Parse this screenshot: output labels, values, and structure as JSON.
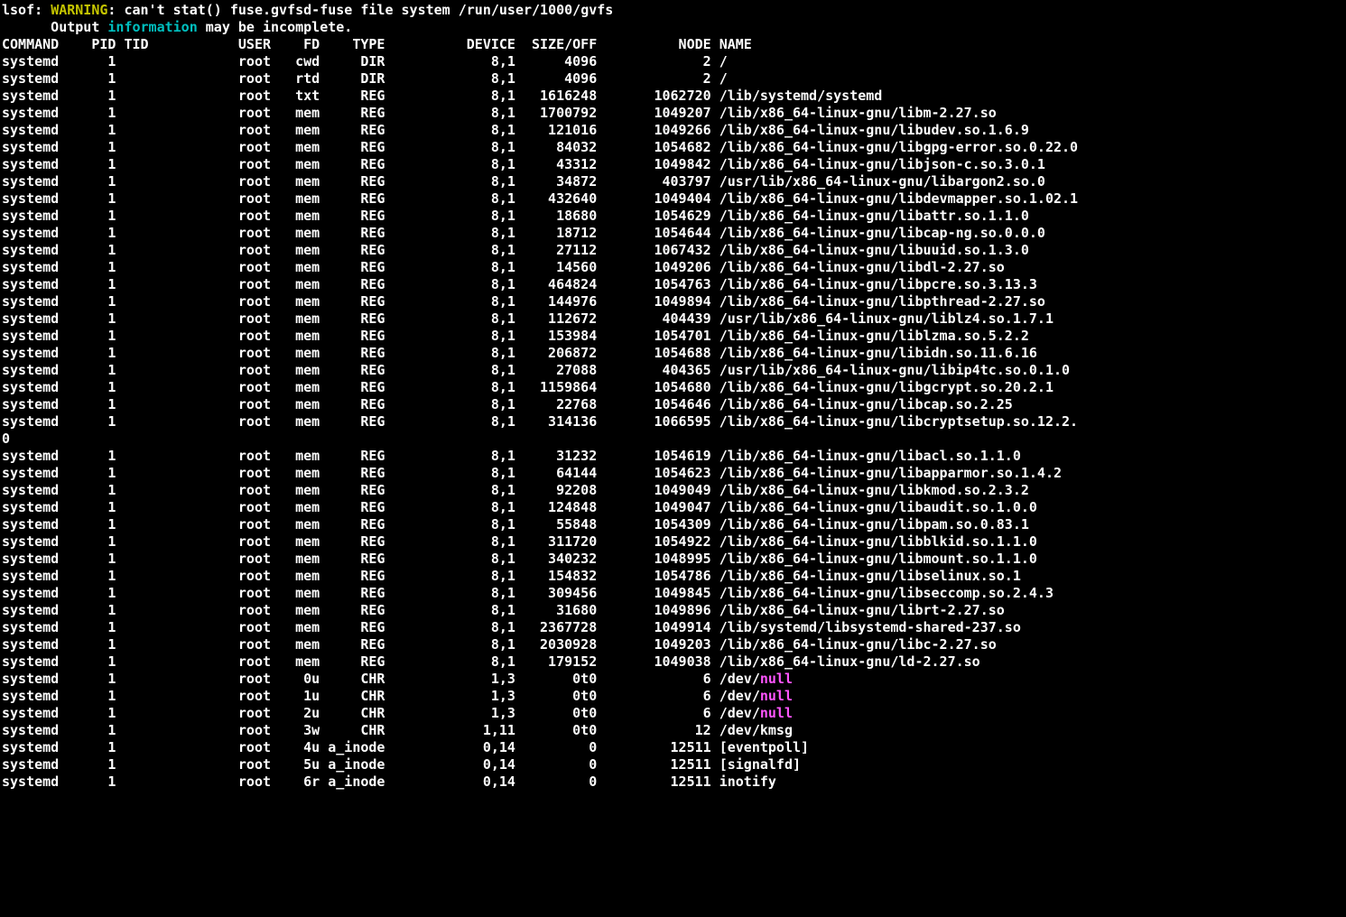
{
  "warn1": {
    "cmd": "lsof:",
    "tag": "WARNING",
    "msg": ": can't stat() fuse.gvfsd-fuse file system /run/user/1000/gvfs"
  },
  "warn2": {
    "pre": "      Output ",
    "kw": "information",
    "post": " may be incomplete."
  },
  "headers": {
    "COMMAND": "COMMAND",
    "PID": "PID",
    "TID": "TID",
    "USER": "USER",
    "FD": "FD",
    "TYPE": "TYPE",
    "DEVICE": "DEVICE",
    "SIZEOFF": "SIZE/OFF",
    "NODE": "NODE",
    "NAME": "NAME"
  },
  "rows": [
    {
      "COMMAND": "systemd",
      "PID": "1",
      "TID": "",
      "USER": "root",
      "FD": "cwd",
      "TYPE": "DIR",
      "DEVICE": "8,1",
      "SIZEOFF": "4096",
      "NODE": "2",
      "NAME": "/"
    },
    {
      "COMMAND": "systemd",
      "PID": "1",
      "TID": "",
      "USER": "root",
      "FD": "rtd",
      "TYPE": "DIR",
      "DEVICE": "8,1",
      "SIZEOFF": "4096",
      "NODE": "2",
      "NAME": "/"
    },
    {
      "COMMAND": "systemd",
      "PID": "1",
      "TID": "",
      "USER": "root",
      "FD": "txt",
      "TYPE": "REG",
      "DEVICE": "8,1",
      "SIZEOFF": "1616248",
      "NODE": "1062720",
      "NAME": "/lib/systemd/systemd"
    },
    {
      "COMMAND": "systemd",
      "PID": "1",
      "TID": "",
      "USER": "root",
      "FD": "mem",
      "TYPE": "REG",
      "DEVICE": "8,1",
      "SIZEOFF": "1700792",
      "NODE": "1049207",
      "NAME": "/lib/x86_64-linux-gnu/libm-2.27.so"
    },
    {
      "COMMAND": "systemd",
      "PID": "1",
      "TID": "",
      "USER": "root",
      "FD": "mem",
      "TYPE": "REG",
      "DEVICE": "8,1",
      "SIZEOFF": "121016",
      "NODE": "1049266",
      "NAME": "/lib/x86_64-linux-gnu/libudev.so.1.6.9"
    },
    {
      "COMMAND": "systemd",
      "PID": "1",
      "TID": "",
      "USER": "root",
      "FD": "mem",
      "TYPE": "REG",
      "DEVICE": "8,1",
      "SIZEOFF": "84032",
      "NODE": "1054682",
      "NAME": "/lib/x86_64-linux-gnu/libgpg-error.so.0.22.0"
    },
    {
      "COMMAND": "systemd",
      "PID": "1",
      "TID": "",
      "USER": "root",
      "FD": "mem",
      "TYPE": "REG",
      "DEVICE": "8,1",
      "SIZEOFF": "43312",
      "NODE": "1049842",
      "NAME": "/lib/x86_64-linux-gnu/libjson-c.so.3.0.1"
    },
    {
      "COMMAND": "systemd",
      "PID": "1",
      "TID": "",
      "USER": "root",
      "FD": "mem",
      "TYPE": "REG",
      "DEVICE": "8,1",
      "SIZEOFF": "34872",
      "NODE": "403797",
      "NAME": "/usr/lib/x86_64-linux-gnu/libargon2.so.0"
    },
    {
      "COMMAND": "systemd",
      "PID": "1",
      "TID": "",
      "USER": "root",
      "FD": "mem",
      "TYPE": "REG",
      "DEVICE": "8,1",
      "SIZEOFF": "432640",
      "NODE": "1049404",
      "NAME": "/lib/x86_64-linux-gnu/libdevmapper.so.1.02.1"
    },
    {
      "COMMAND": "systemd",
      "PID": "1",
      "TID": "",
      "USER": "root",
      "FD": "mem",
      "TYPE": "REG",
      "DEVICE": "8,1",
      "SIZEOFF": "18680",
      "NODE": "1054629",
      "NAME": "/lib/x86_64-linux-gnu/libattr.so.1.1.0"
    },
    {
      "COMMAND": "systemd",
      "PID": "1",
      "TID": "",
      "USER": "root",
      "FD": "mem",
      "TYPE": "REG",
      "DEVICE": "8,1",
      "SIZEOFF": "18712",
      "NODE": "1054644",
      "NAME": "/lib/x86_64-linux-gnu/libcap-ng.so.0.0.0"
    },
    {
      "COMMAND": "systemd",
      "PID": "1",
      "TID": "",
      "USER": "root",
      "FD": "mem",
      "TYPE": "REG",
      "DEVICE": "8,1",
      "SIZEOFF": "27112",
      "NODE": "1067432",
      "NAME": "/lib/x86_64-linux-gnu/libuuid.so.1.3.0"
    },
    {
      "COMMAND": "systemd",
      "PID": "1",
      "TID": "",
      "USER": "root",
      "FD": "mem",
      "TYPE": "REG",
      "DEVICE": "8,1",
      "SIZEOFF": "14560",
      "NODE": "1049206",
      "NAME": "/lib/x86_64-linux-gnu/libdl-2.27.so"
    },
    {
      "COMMAND": "systemd",
      "PID": "1",
      "TID": "",
      "USER": "root",
      "FD": "mem",
      "TYPE": "REG",
      "DEVICE": "8,1",
      "SIZEOFF": "464824",
      "NODE": "1054763",
      "NAME": "/lib/x86_64-linux-gnu/libpcre.so.3.13.3"
    },
    {
      "COMMAND": "systemd",
      "PID": "1",
      "TID": "",
      "USER": "root",
      "FD": "mem",
      "TYPE": "REG",
      "DEVICE": "8,1",
      "SIZEOFF": "144976",
      "NODE": "1049894",
      "NAME": "/lib/x86_64-linux-gnu/libpthread-2.27.so"
    },
    {
      "COMMAND": "systemd",
      "PID": "1",
      "TID": "",
      "USER": "root",
      "FD": "mem",
      "TYPE": "REG",
      "DEVICE": "8,1",
      "SIZEOFF": "112672",
      "NODE": "404439",
      "NAME": "/usr/lib/x86_64-linux-gnu/liblz4.so.1.7.1"
    },
    {
      "COMMAND": "systemd",
      "PID": "1",
      "TID": "",
      "USER": "root",
      "FD": "mem",
      "TYPE": "REG",
      "DEVICE": "8,1",
      "SIZEOFF": "153984",
      "NODE": "1054701",
      "NAME": "/lib/x86_64-linux-gnu/liblzma.so.5.2.2"
    },
    {
      "COMMAND": "systemd",
      "PID": "1",
      "TID": "",
      "USER": "root",
      "FD": "mem",
      "TYPE": "REG",
      "DEVICE": "8,1",
      "SIZEOFF": "206872",
      "NODE": "1054688",
      "NAME": "/lib/x86_64-linux-gnu/libidn.so.11.6.16"
    },
    {
      "COMMAND": "systemd",
      "PID": "1",
      "TID": "",
      "USER": "root",
      "FD": "mem",
      "TYPE": "REG",
      "DEVICE": "8,1",
      "SIZEOFF": "27088",
      "NODE": "404365",
      "NAME": "/usr/lib/x86_64-linux-gnu/libip4tc.so.0.1.0"
    },
    {
      "COMMAND": "systemd",
      "PID": "1",
      "TID": "",
      "USER": "root",
      "FD": "mem",
      "TYPE": "REG",
      "DEVICE": "8,1",
      "SIZEOFF": "1159864",
      "NODE": "1054680",
      "NAME": "/lib/x86_64-linux-gnu/libgcrypt.so.20.2.1"
    },
    {
      "COMMAND": "systemd",
      "PID": "1",
      "TID": "",
      "USER": "root",
      "FD": "mem",
      "TYPE": "REG",
      "DEVICE": "8,1",
      "SIZEOFF": "22768",
      "NODE": "1054646",
      "NAME": "/lib/x86_64-linux-gnu/libcap.so.2.25"
    },
    {
      "COMMAND": "systemd",
      "PID": "1",
      "TID": "",
      "USER": "root",
      "FD": "mem",
      "TYPE": "REG",
      "DEVICE": "8,1",
      "SIZEOFF": "314136",
      "NODE": "1066595",
      "NAME": "/lib/x86_64-linux-gnu/libcryptsetup.so.12.2.",
      "WRAP": "0"
    },
    {
      "COMMAND": "systemd",
      "PID": "1",
      "TID": "",
      "USER": "root",
      "FD": "mem",
      "TYPE": "REG",
      "DEVICE": "8,1",
      "SIZEOFF": "31232",
      "NODE": "1054619",
      "NAME": "/lib/x86_64-linux-gnu/libacl.so.1.1.0"
    },
    {
      "COMMAND": "systemd",
      "PID": "1",
      "TID": "",
      "USER": "root",
      "FD": "mem",
      "TYPE": "REG",
      "DEVICE": "8,1",
      "SIZEOFF": "64144",
      "NODE": "1054623",
      "NAME": "/lib/x86_64-linux-gnu/libapparmor.so.1.4.2"
    },
    {
      "COMMAND": "systemd",
      "PID": "1",
      "TID": "",
      "USER": "root",
      "FD": "mem",
      "TYPE": "REG",
      "DEVICE": "8,1",
      "SIZEOFF": "92208",
      "NODE": "1049049",
      "NAME": "/lib/x86_64-linux-gnu/libkmod.so.2.3.2"
    },
    {
      "COMMAND": "systemd",
      "PID": "1",
      "TID": "",
      "USER": "root",
      "FD": "mem",
      "TYPE": "REG",
      "DEVICE": "8,1",
      "SIZEOFF": "124848",
      "NODE": "1049047",
      "NAME": "/lib/x86_64-linux-gnu/libaudit.so.1.0.0"
    },
    {
      "COMMAND": "systemd",
      "PID": "1",
      "TID": "",
      "USER": "root",
      "FD": "mem",
      "TYPE": "REG",
      "DEVICE": "8,1",
      "SIZEOFF": "55848",
      "NODE": "1054309",
      "NAME": "/lib/x86_64-linux-gnu/libpam.so.0.83.1"
    },
    {
      "COMMAND": "systemd",
      "PID": "1",
      "TID": "",
      "USER": "root",
      "FD": "mem",
      "TYPE": "REG",
      "DEVICE": "8,1",
      "SIZEOFF": "311720",
      "NODE": "1054922",
      "NAME": "/lib/x86_64-linux-gnu/libblkid.so.1.1.0"
    },
    {
      "COMMAND": "systemd",
      "PID": "1",
      "TID": "",
      "USER": "root",
      "FD": "mem",
      "TYPE": "REG",
      "DEVICE": "8,1",
      "SIZEOFF": "340232",
      "NODE": "1048995",
      "NAME": "/lib/x86_64-linux-gnu/libmount.so.1.1.0"
    },
    {
      "COMMAND": "systemd",
      "PID": "1",
      "TID": "",
      "USER": "root",
      "FD": "mem",
      "TYPE": "REG",
      "DEVICE": "8,1",
      "SIZEOFF": "154832",
      "NODE": "1054786",
      "NAME": "/lib/x86_64-linux-gnu/libselinux.so.1"
    },
    {
      "COMMAND": "systemd",
      "PID": "1",
      "TID": "",
      "USER": "root",
      "FD": "mem",
      "TYPE": "REG",
      "DEVICE": "8,1",
      "SIZEOFF": "309456",
      "NODE": "1049845",
      "NAME": "/lib/x86_64-linux-gnu/libseccomp.so.2.4.3"
    },
    {
      "COMMAND": "systemd",
      "PID": "1",
      "TID": "",
      "USER": "root",
      "FD": "mem",
      "TYPE": "REG",
      "DEVICE": "8,1",
      "SIZEOFF": "31680",
      "NODE": "1049896",
      "NAME": "/lib/x86_64-linux-gnu/librt-2.27.so"
    },
    {
      "COMMAND": "systemd",
      "PID": "1",
      "TID": "",
      "USER": "root",
      "FD": "mem",
      "TYPE": "REG",
      "DEVICE": "8,1",
      "SIZEOFF": "2367728",
      "NODE": "1049914",
      "NAME": "/lib/systemd/libsystemd-shared-237.so"
    },
    {
      "COMMAND": "systemd",
      "PID": "1",
      "TID": "",
      "USER": "root",
      "FD": "mem",
      "TYPE": "REG",
      "DEVICE": "8,1",
      "SIZEOFF": "2030928",
      "NODE": "1049203",
      "NAME": "/lib/x86_64-linux-gnu/libc-2.27.so"
    },
    {
      "COMMAND": "systemd",
      "PID": "1",
      "TID": "",
      "USER": "root",
      "FD": "mem",
      "TYPE": "REG",
      "DEVICE": "8,1",
      "SIZEOFF": "179152",
      "NODE": "1049038",
      "NAME": "/lib/x86_64-linux-gnu/ld-2.27.so"
    },
    {
      "COMMAND": "systemd",
      "PID": "1",
      "TID": "",
      "USER": "root",
      "FD": "0u",
      "TYPE": "CHR",
      "DEVICE": "1,3",
      "SIZEOFF": "0t0",
      "NODE": "6",
      "NAME": "/dev/",
      "HL": "null"
    },
    {
      "COMMAND": "systemd",
      "PID": "1",
      "TID": "",
      "USER": "root",
      "FD": "1u",
      "TYPE": "CHR",
      "DEVICE": "1,3",
      "SIZEOFF": "0t0",
      "NODE": "6",
      "NAME": "/dev/",
      "HL": "null"
    },
    {
      "COMMAND": "systemd",
      "PID": "1",
      "TID": "",
      "USER": "root",
      "FD": "2u",
      "TYPE": "CHR",
      "DEVICE": "1,3",
      "SIZEOFF": "0t0",
      "NODE": "6",
      "NAME": "/dev/",
      "HL": "null"
    },
    {
      "COMMAND": "systemd",
      "PID": "1",
      "TID": "",
      "USER": "root",
      "FD": "3w",
      "TYPE": "CHR",
      "DEVICE": "1,11",
      "SIZEOFF": "0t0",
      "NODE": "12",
      "NAME": "/dev/kmsg"
    },
    {
      "COMMAND": "systemd",
      "PID": "1",
      "TID": "",
      "USER": "root",
      "FD": "4u",
      "TYPE": "a_inode",
      "DEVICE": "0,14",
      "SIZEOFF": "0",
      "NODE": "12511",
      "NAME": "[eventpoll]"
    },
    {
      "COMMAND": "systemd",
      "PID": "1",
      "TID": "",
      "USER": "root",
      "FD": "5u",
      "TYPE": "a_inode",
      "DEVICE": "0,14",
      "SIZEOFF": "0",
      "NODE": "12511",
      "NAME": "[signalfd]"
    },
    {
      "COMMAND": "systemd",
      "PID": "1",
      "TID": "",
      "USER": "root",
      "FD": "6r",
      "TYPE": "a_inode",
      "DEVICE": "0,14",
      "SIZEOFF": "0",
      "NODE": "12511",
      "NAME": "inotify"
    }
  ]
}
